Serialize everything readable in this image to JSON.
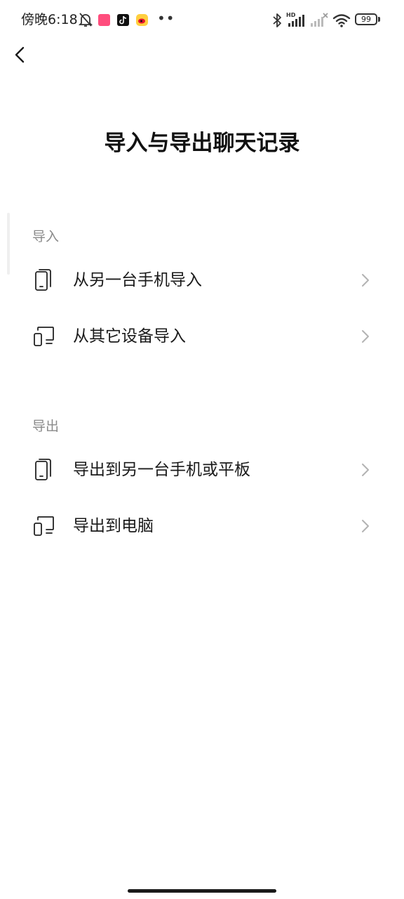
{
  "status_bar": {
    "time": "傍晚6:18",
    "more_indicator": "••",
    "battery_level": "99",
    "icons": [
      "mute-bell-icon",
      "app-notification-icon",
      "tiktok-icon",
      "weibo-icon",
      "bluetooth-icon",
      "hd-signal-icon",
      "no-signal-icon",
      "wifi-icon",
      "battery-icon"
    ]
  },
  "nav": {
    "back_icon": "chevron-left-icon",
    "title": "导入与导出聊天记录"
  },
  "import_section": {
    "label": "导入",
    "items": [
      {
        "label": "从另一台手机导入",
        "icon": "phone-icon"
      },
      {
        "label": "从其它设备导入",
        "icon": "computer-icon"
      }
    ]
  },
  "export_section": {
    "label": "导出",
    "items": [
      {
        "label": "导出到另一台手机或平板",
        "icon": "phone-icon"
      },
      {
        "label": "导出到电脑",
        "icon": "computer-icon"
      }
    ]
  },
  "colors": {
    "text_primary": "#1a1a1a",
    "text_secondary": "#8a8a8a",
    "chevron": "#b3b3b3",
    "background": "#ffffff"
  }
}
